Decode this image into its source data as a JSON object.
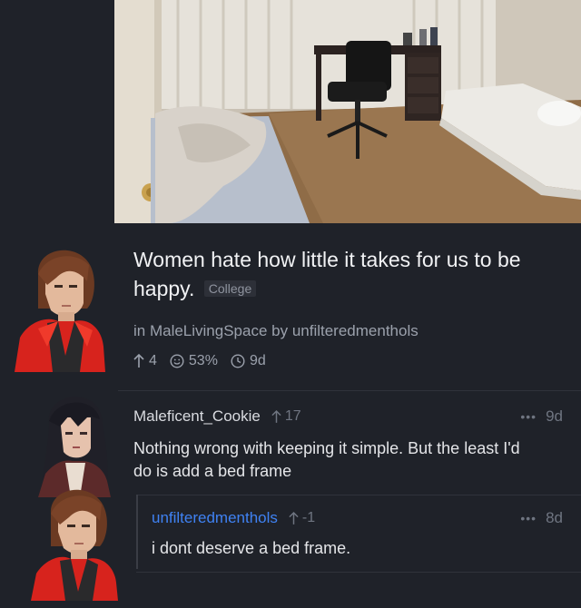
{
  "post": {
    "title": "Women hate how little it takes for us to be happy.",
    "flair": "College",
    "meta": "in MaleLivingSpace by unfilteredmenthols",
    "upvotes": "4",
    "ratio": "53%",
    "age": "9d"
  },
  "comments": [
    {
      "author": "Maleficent_Cookie",
      "score": "17",
      "age": "9d",
      "more": "•••",
      "body": "Nothing wrong with keeping it simple. But the least I'd do is add a bed frame"
    },
    {
      "author": "unfilteredmenthols",
      "score": "-1",
      "age": "8d",
      "more": "•••",
      "body": "i dont deserve a bed frame."
    }
  ],
  "colors": {
    "background": "#1f2229",
    "op_accent": "#3f82f3",
    "muted": "#6f7581"
  }
}
